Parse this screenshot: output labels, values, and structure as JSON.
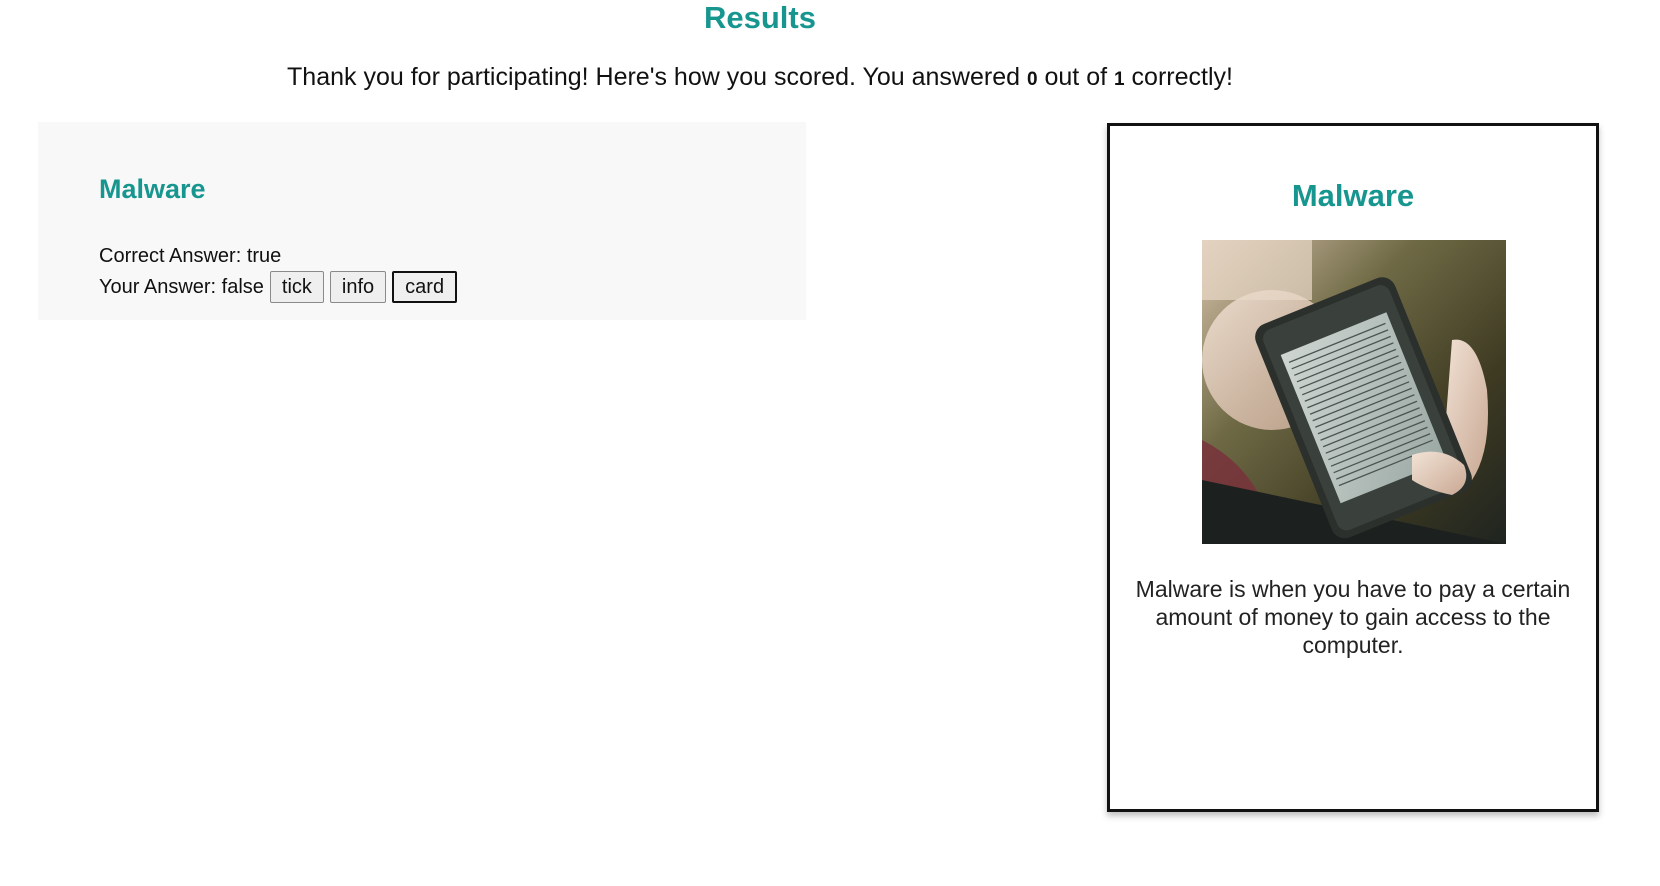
{
  "header": {
    "title": "Results",
    "summary_prefix": "Thank you for participating! Here's how you scored. You answered",
    "correct_count": "0",
    "summary_middle": "out of",
    "total_count": "1",
    "summary_suffix": "correctly!"
  },
  "result": {
    "title": "Malware",
    "correct_label": "Correct Answer:",
    "correct_value": "true",
    "your_label": "Your Answer:",
    "your_value": "false",
    "buttons": {
      "tick": "tick",
      "info": "info",
      "card": "card"
    }
  },
  "card": {
    "title": "Malware",
    "image_subject": "hand-holding-kindle-ereader-photo",
    "description": "Malware is when you have to pay a certain amount of money to gain access to the computer."
  },
  "colors": {
    "accent": "#17968f",
    "panel_bg": "#f8f8f8",
    "card_border": "#111111"
  }
}
